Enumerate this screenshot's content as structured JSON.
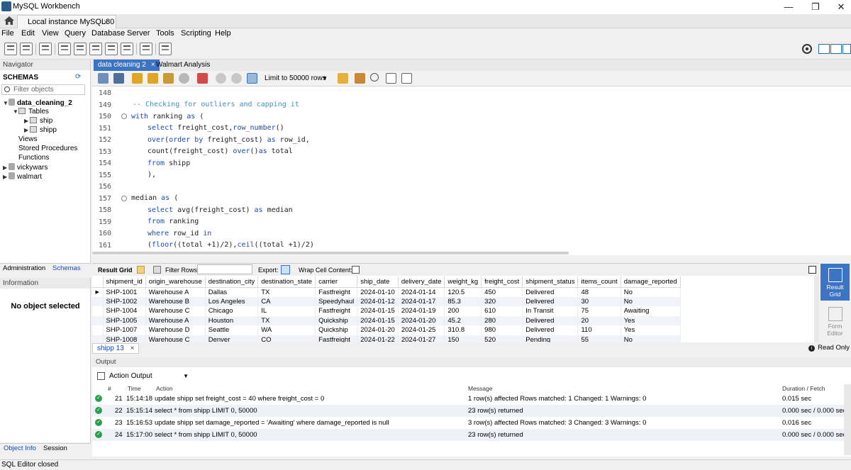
{
  "window": {
    "title": "MySQL Workbench",
    "minimize": "—",
    "maximize": "❐",
    "close": "✕"
  },
  "connection_tab": {
    "label": "Local instance MySQL80",
    "close": "×"
  },
  "menu": [
    "File",
    "Edit",
    "View",
    "Query",
    "Database",
    "Server",
    "Tools",
    "Scripting",
    "Help"
  ],
  "navigator": {
    "header": "Navigator",
    "schemas_label": "SCHEMAS",
    "filter_placeholder": "Filter objects",
    "tree": {
      "schema1": "data_cleaning_2",
      "tables": "Tables",
      "table1": "ship",
      "table2": "shipp",
      "views": "Views",
      "procs": "Stored Procedures",
      "funcs": "Functions",
      "schema2": "vickywars",
      "schema3": "walmart"
    },
    "tabs": [
      "Administration",
      "Schemas"
    ]
  },
  "information": {
    "header": "Information",
    "empty": "No object selected",
    "tabs": [
      "Object Info",
      "Session"
    ]
  },
  "editor_tabs": [
    {
      "label": "data cleaning 2",
      "close": "×"
    },
    {
      "label": "Walmart Analysis"
    }
  ],
  "editor_toolbar": {
    "limit": "Limit to 50000 rows"
  },
  "code": {
    "lines": [
      "148",
      "149",
      "150",
      "151",
      "152",
      "153",
      "154",
      "155",
      "156",
      "157",
      "158",
      "159",
      "160",
      "161"
    ],
    "l149": "-- Checking for outliers and capping it",
    "l150_kw": "with",
    "l150_rest": " ranking ",
    "l150_kw2": "as",
    "l150_end": " (",
    "l151_kw": "select",
    "l151_a": " freight_cost,",
    "l151_fn": "row_number",
    "l151_b": "()",
    "l152_fn": "over",
    "l152_a": "(",
    "l152_kw": "order by",
    "l152_b": " freight_cost) ",
    "l152_kw2": "as",
    "l152_c": " row_id,",
    "l153_a": "count(freight_cost) ",
    "l153_fn": "over",
    "l153_b": "()",
    "l153_kw": "as",
    "l153_c": " total",
    "l154_kw": "from",
    "l154_a": " shipp",
    "l155": "),",
    "l157_a": "median ",
    "l157_kw": "as",
    "l157_b": " (",
    "l158_kw": "select",
    "l158_a": " avg(freight_cost) ",
    "l158_kw2": "as",
    "l158_b": " median",
    "l159_kw": "from",
    "l159_a": " ranking",
    "l160_kw": "where",
    "l160_a": " row_id ",
    "l160_kw2": "in",
    "l161_a": "(",
    "l161_fn": "floor",
    "l161_b": "((total +1)/2),",
    "l161_fn2": "ceil",
    "l161_c": "((total +1)/2)"
  },
  "result_toolbar": {
    "grid": "Result Grid",
    "filter": "Filter Rows:",
    "export": "Export:",
    "wrap": "Wrap Cell Content:"
  },
  "result_grid": {
    "columns": [
      "shipment_id",
      "origin_warehouse",
      "destination_city",
      "destination_state",
      "carrier",
      "ship_date",
      "delivery_date",
      "weight_kg",
      "freight_cost",
      "shipment_status",
      "items_count",
      "damage_reported"
    ],
    "rows": [
      [
        "SHP-1001",
        "Warehouse A",
        "Dallas",
        "TX",
        "Fastfreight",
        "2024-01-10",
        "2024-01-14",
        "120.5",
        "450",
        "Delivered",
        "48",
        "No"
      ],
      [
        "SHP-1002",
        "Warehouse B",
        "Los Angeles",
        "CA",
        "Speedyhaul",
        "2024-01-12",
        "2024-01-17",
        "85.3",
        "320",
        "Delivered",
        "30",
        "No"
      ],
      [
        "SHP-1004",
        "Warehouse C",
        "Chicago",
        "IL",
        "Fastfreight",
        "2024-01-15",
        "2024-01-19",
        "200",
        "610",
        "In Transit",
        "75",
        "Awaiting"
      ],
      [
        "SHP-1005",
        "Warehouse A",
        "Houston",
        "TX",
        "Quickship",
        "2024-01-15",
        "2024-01-20",
        "45.2",
        "280",
        "Delivered",
        "20",
        "Yes"
      ],
      [
        "SHP-1007",
        "Warehouse D",
        "Seattle",
        "WA",
        "Quickship",
        "2024-01-20",
        "2024-01-25",
        "310.8",
        "980",
        "Delivered",
        "110",
        "Yes"
      ],
      [
        "SHP-1008",
        "Warehouse C",
        "Denver",
        "CO",
        "Fastfreight",
        "2024-01-22",
        "2024-01-27",
        "150",
        "520",
        "Pending",
        "55",
        "No"
      ]
    ]
  },
  "side_buttons": {
    "result_grid": "Result Grid",
    "form_editor": "Form Editor"
  },
  "result_tab": {
    "label": "shipp 13",
    "close": "×"
  },
  "read_only": "Read Only",
  "output": {
    "header": "Output",
    "selector": "Action Output",
    "columns": {
      "num": "#",
      "time": "Time",
      "action": "Action",
      "message": "Message",
      "duration": "Duration / Fetch"
    },
    "rows": [
      {
        "num": "21",
        "time": "15:14:18",
        "action": "update shipp set freight_cost = 40 where freight_cost = 0",
        "message": "1 row(s) affected Rows matched: 1  Changed: 1  Warnings: 0",
        "duration": "0.015 sec"
      },
      {
        "num": "22",
        "time": "15:15:14",
        "action": "select * from shipp LIMIT 0, 50000",
        "message": "23 row(s) returned",
        "duration": "0.000 sec / 0.000 sec"
      },
      {
        "num": "23",
        "time": "15:16:53",
        "action": "update shipp set damage_reported = 'Awaiting' where damage_reported is null",
        "message": "3 row(s) affected Rows matched: 3  Changed: 3  Warnings: 0",
        "duration": "0.016 sec"
      },
      {
        "num": "24",
        "time": "15:17:00",
        "action": "select * from shipp LIMIT 0, 50000",
        "message": "23 row(s) returned",
        "duration": "0.000 sec / 0.000 sec"
      }
    ]
  },
  "status": "SQL Editor closed"
}
